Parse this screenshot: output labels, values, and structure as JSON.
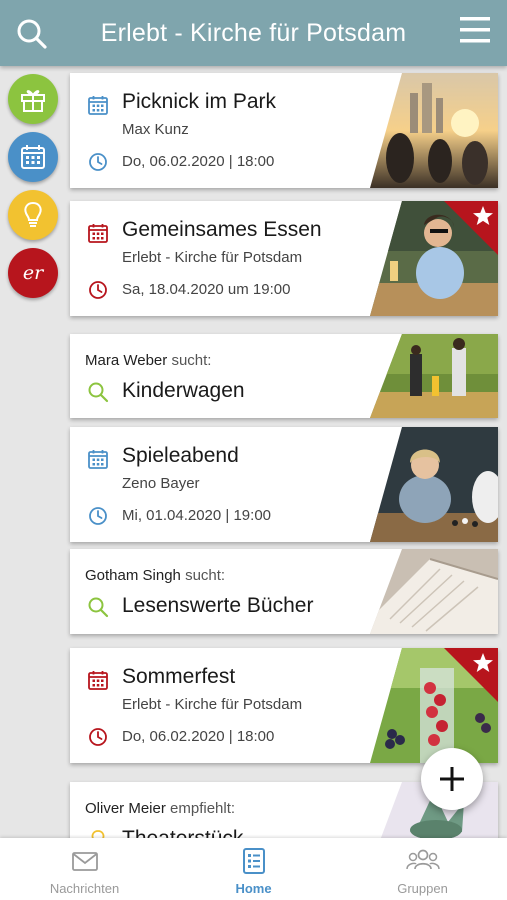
{
  "header": {
    "title": "Erlebt - Kirche für Potsdam",
    "bg_color": "#7fa5ad"
  },
  "side_buttons": [
    {
      "icon": "gift-icon",
      "color": "#8cc43f"
    },
    {
      "icon": "calendar-icon",
      "color": "#4a90c8"
    },
    {
      "icon": "lightbulb-icon",
      "color": "#f2c230"
    },
    {
      "icon": "er-logo-icon",
      "color": "#b7151d",
      "text": "er"
    }
  ],
  "cards": [
    {
      "type": "event",
      "title": "Picknick im Park",
      "subtitle": "Max Kunz",
      "date": "Do, 06.02.2020 | 18:00",
      "accent": "#4a90c8",
      "featured": false
    },
    {
      "type": "event",
      "title": "Gemeinsames Essen",
      "subtitle": "Erlebt - Kirche für Potsdam",
      "date": "Sa, 18.04.2020 um 19:00",
      "accent": "#b7151d",
      "featured": true
    },
    {
      "type": "search",
      "person": "Mara Weber",
      "verb": "sucht:",
      "title": "Kinderwagen",
      "accent": "#8cc43f"
    },
    {
      "type": "event",
      "title": "Spieleabend",
      "subtitle": "Zeno Bayer",
      "date": "Mi, 01.04.2020 | 19:00",
      "accent": "#4a90c8",
      "featured": false
    },
    {
      "type": "search",
      "person": "Gotham Singh",
      "verb": "sucht:",
      "title": "Lesenswerte Bücher",
      "accent": "#8cc43f"
    },
    {
      "type": "event",
      "title": "Sommerfest",
      "subtitle": "Erlebt - Kirche für Potsdam",
      "date": "Do, 06.02.2020 | 18:00",
      "accent": "#b7151d",
      "featured": true
    },
    {
      "type": "recommend",
      "person": "Oliver Meier",
      "verb": "empfiehlt:",
      "title": "Theaterstück",
      "accent": "#f2c230"
    }
  ],
  "bottom_nav": [
    {
      "label": "Nachrichten",
      "icon": "mail-icon",
      "active": false
    },
    {
      "label": "Home",
      "icon": "home-list-icon",
      "active": true
    },
    {
      "label": "Gruppen",
      "icon": "group-icon",
      "active": false
    }
  ],
  "colors": {
    "active_tab": "#4a90c8",
    "inactive_tab": "#9a9a9a",
    "featured_ribbon": "#b7151d"
  }
}
